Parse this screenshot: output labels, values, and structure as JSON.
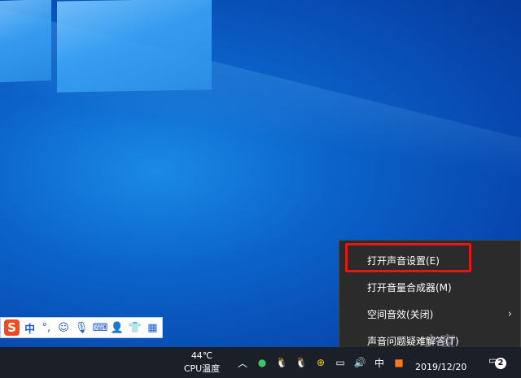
{
  "ime_toolbar": {
    "logo": "S",
    "lang": "中",
    "punct": "°,",
    "icons": [
      "emoji-icon",
      "microphone-icon",
      "keyboard-icon",
      "user-icon",
      "shirt-icon",
      "grid-icon"
    ]
  },
  "taskbar": {
    "temp_value": "44℃",
    "temp_label": "CPU温度",
    "tray_icons": [
      "chevron-up-icon",
      "wechat-icon",
      "qq-icon",
      "qq-icon",
      "plus-icon",
      "network-icon",
      "volume-icon",
      "ime-icon",
      "app-icon"
    ],
    "date": "2019/12/20",
    "notifications": "2"
  },
  "context_menu": {
    "items": [
      {
        "label": "打开声音设置(E)"
      },
      {
        "label": "打开音量合成器(M)"
      },
      {
        "label": "空间音效(关闭)",
        "arrow": "›"
      },
      {
        "label": "声音问题疑难解答(T)"
      }
    ]
  },
  "watermark": "之家"
}
